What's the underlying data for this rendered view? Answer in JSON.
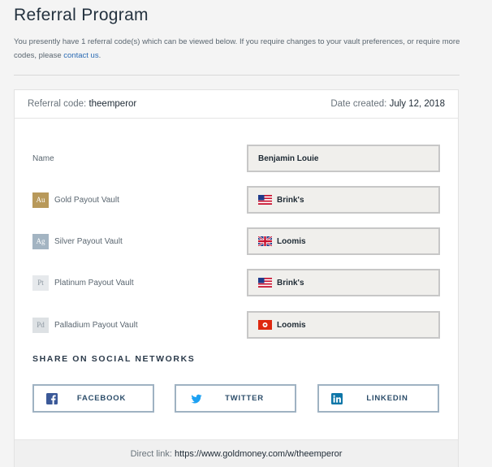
{
  "header": {
    "title": "Referral Program",
    "intro_text": "You presently have 1 referral code(s) which can be viewed below. If you require changes to your vault preferences, or require more codes, please ",
    "contact_link": "contact us",
    "intro_end": "."
  },
  "card": {
    "referral_code_label": "Referral code:",
    "referral_code_value": "theemperor",
    "date_created_label": "Date created:",
    "date_created_value": "July 12, 2018"
  },
  "fields": [
    {
      "label": "Name",
      "value": "Benjamin Louie"
    },
    {
      "metal_symbol": "Au",
      "label": "Gold Payout Vault",
      "value": "Brink's",
      "flag": "us-flag-icon",
      "metal_color": "#b8995a"
    },
    {
      "metal_symbol": "Ag",
      "label": "Silver Payout Vault",
      "value": "Loomis",
      "flag": "uk-flag-icon",
      "metal_color": "#a3b4c2"
    },
    {
      "metal_symbol": "Pt",
      "label": "Platinum Payout Vault",
      "value": "Brink's",
      "flag": "us-flag-icon",
      "metal_color": "#e6e9ec"
    },
    {
      "metal_symbol": "Pd",
      "label": "Palladium Payout Vault",
      "value": "Loomis",
      "flag": "hk-flag-icon",
      "metal_color": "#dde1e4"
    }
  ],
  "share": {
    "title": "SHARE ON SOCIAL NETWORKS",
    "facebook": "FACEBOOK",
    "twitter": "TWITTER",
    "linkedin": "LINKEDIN"
  },
  "footer": {
    "direct_link_label": "Direct link:",
    "direct_link_value": "https://www.goldmoney.com/w/theemperor"
  },
  "colors": {
    "link": "#2a6ab3",
    "field_bg": "#f0efec",
    "social_border": "#9fb2c2",
    "facebook": "#3b5998",
    "twitter": "#1da1f2",
    "linkedin": "#0e76a8"
  }
}
